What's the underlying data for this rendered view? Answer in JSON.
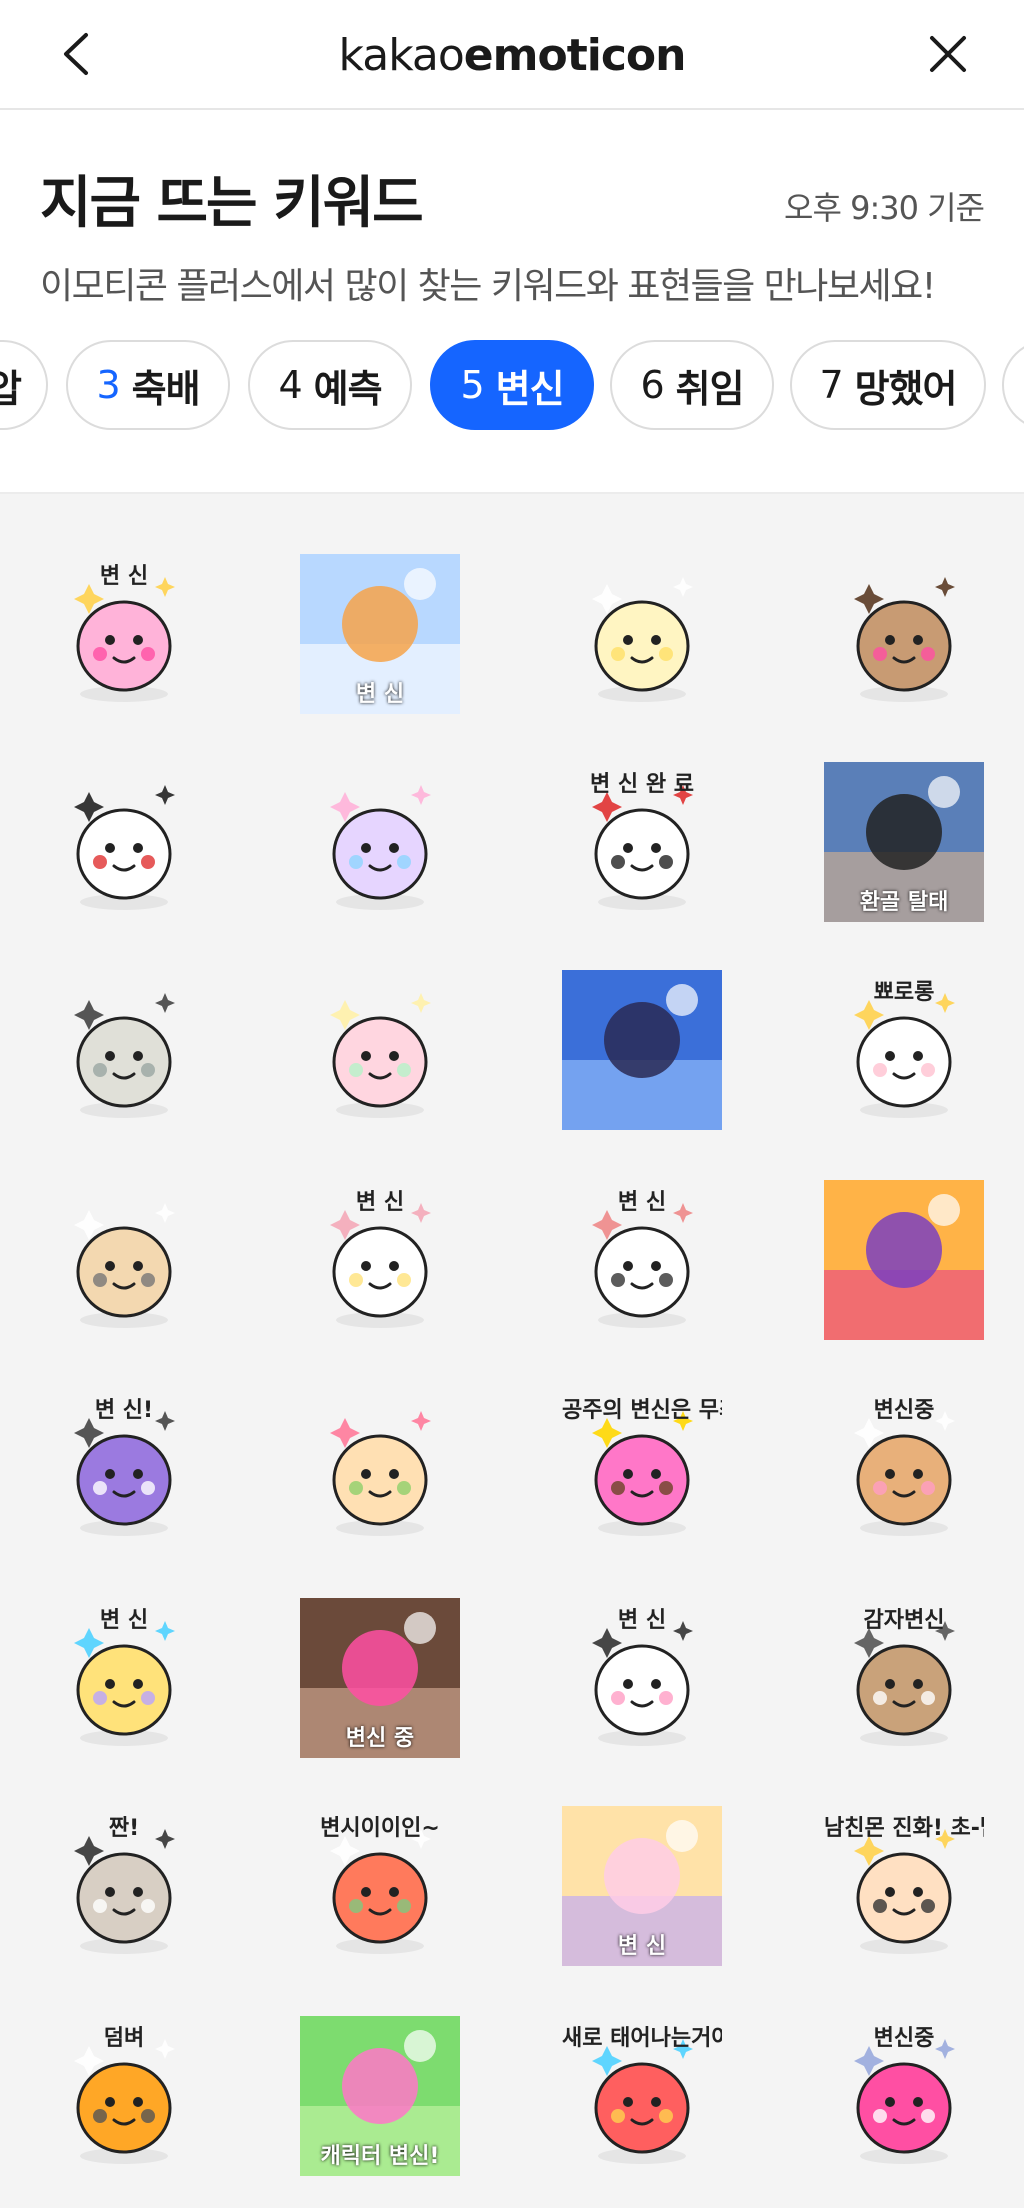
{
  "header": {
    "logo_light": "kakao",
    "logo_bold": "emoticon"
  },
  "section": {
    "title": "지금 뜨는 키워드",
    "time": "오후 9:30 기준",
    "subtitle": "이모티콘 플러스에서 많이 찾는 키워드와 표현들을 만나보세요!"
  },
  "chips": [
    {
      "num": "",
      "word": "압"
    },
    {
      "num": "3",
      "word": "축배"
    },
    {
      "num": "4",
      "word": "예측"
    },
    {
      "num": "5",
      "word": "변신"
    },
    {
      "num": "6",
      "word": "취임"
    },
    {
      "num": "7",
      "word": "망했어"
    },
    {
      "num": "",
      "word": ""
    }
  ],
  "active_chip": "5 변신",
  "colors": {
    "accent": "#1565ff",
    "grid_bg": "#f4f4f4"
  },
  "stickers": [
    {
      "name": "magical-girl",
      "text": "변 신"
    },
    {
      "name": "rainbow-bird-photo",
      "text": "변 신"
    },
    {
      "name": "sparkle-blob",
      "text": ""
    },
    {
      "name": "princess-hamster",
      "text": ""
    },
    {
      "name": "puppy-cape",
      "text": ""
    },
    {
      "name": "bunny-ballerina",
      "text": ""
    },
    {
      "name": "dancing-lady",
      "text": "변 신 완 료"
    },
    {
      "name": "anime-muscle",
      "text": "환골 탈태"
    },
    {
      "name": "dino-creature",
      "text": ""
    },
    {
      "name": "rainbow-puff",
      "text": ""
    },
    {
      "name": "anime-girl-sparkle",
      "text": ""
    },
    {
      "name": "ghost-wand",
      "text": "뾰로롱"
    },
    {
      "name": "peanut-bird",
      "text": ""
    },
    {
      "name": "bunny-dress",
      "text": "변 신"
    },
    {
      "name": "man-shorts",
      "text": "변 신"
    },
    {
      "name": "witch-girl",
      "text": ""
    },
    {
      "name": "witch-kid",
      "text": "변 신!"
    },
    {
      "name": "hamster-swim",
      "text": ""
    },
    {
      "name": "princess-transform",
      "text": "공주의 변신은 무죄"
    },
    {
      "name": "dog-mirror",
      "text": "변신중"
    },
    {
      "name": "ice-cream-chick",
      "text": "변 신"
    },
    {
      "name": "woman-photo",
      "text": "변신 중"
    },
    {
      "name": "cross-arms-face",
      "text": "변 신"
    },
    {
      "name": "potato-cat",
      "text": "감자변신"
    },
    {
      "name": "seal-jump",
      "text": "짠!"
    },
    {
      "name": "peach-dude",
      "text": "변시이이인~"
    },
    {
      "name": "hamster-stack",
      "text": "변 신"
    },
    {
      "name": "boyfriend-evolve",
      "text": "남친몬 진화! 초-남친몬"
    },
    {
      "name": "robot-mech",
      "text": "덤벼"
    },
    {
      "name": "character-transform",
      "text": "캐릭터 변신!"
    },
    {
      "name": "rainbow-chick",
      "text": "새로 태어나는거야"
    },
    {
      "name": "pink-hair-mirror",
      "text": "변신중"
    }
  ]
}
